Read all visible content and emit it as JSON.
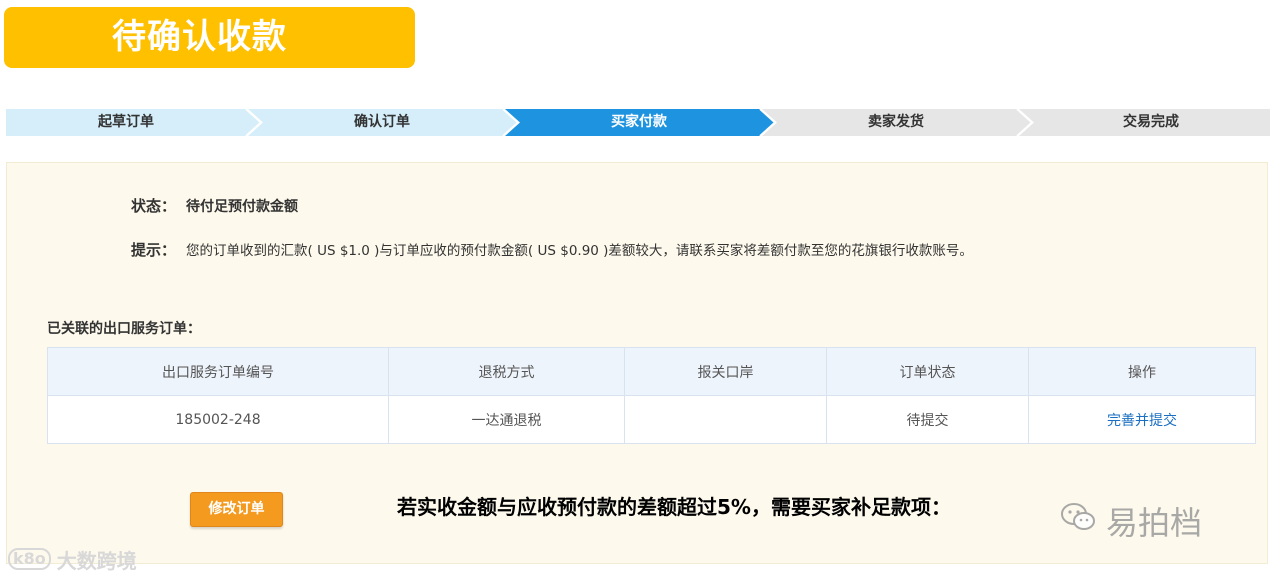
{
  "banner": {
    "title": "待确认收款"
  },
  "steps": [
    {
      "label": "起草订单",
      "state": "done"
    },
    {
      "label": "确认订单",
      "state": "done"
    },
    {
      "label": "买家付款",
      "state": "active"
    },
    {
      "label": "卖家发货",
      "state": "pending"
    },
    {
      "label": "交易完成",
      "state": "pending"
    }
  ],
  "colors": {
    "banner": "#ffc000",
    "step_done": "#d5eefa",
    "step_active": "#1e93e0",
    "step_pending": "#e6e6e6",
    "panel_bg": "#fdf9ec",
    "link": "#1a6fc2",
    "button": "#f39a1f"
  },
  "status": {
    "label": "状态：",
    "value": "待付足预付款金额"
  },
  "hint": {
    "label": "提示：",
    "text": "您的订单收到的汇款( US $1.0 )与订单应收的预付款金额( US $0.90 )差额较大，请联系买家将差额付款至您的花旗银行收款账号。"
  },
  "related": {
    "title": "已关联的出口服务订单：",
    "columns": [
      "出口服务订单编号",
      "退税方式",
      "报关口岸",
      "订单状态",
      "操作"
    ],
    "rows": [
      {
        "order_no": "185002-248",
        "tax_refund": "一达通退税",
        "port": "",
        "status": "待提交",
        "action": "完善并提交"
      }
    ]
  },
  "modify_button": "修改订单",
  "note": "若实收金额与应收预付款的差额超过5%，需要买家补足款项：",
  "watermarks": {
    "right": "易拍档",
    "left_logo": "k8o",
    "left": "大数跨境"
  }
}
